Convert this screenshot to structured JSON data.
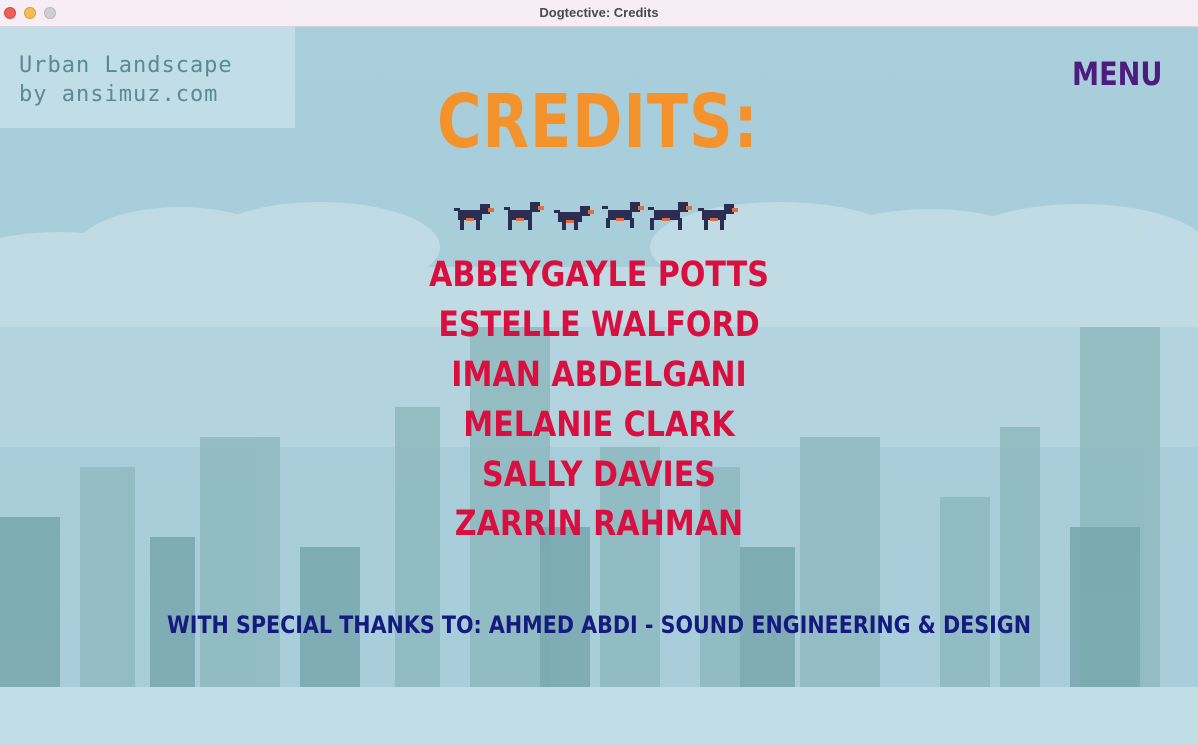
{
  "window": {
    "title": "Dogtective: Credits"
  },
  "attribution": {
    "line1": "Urban Landscape",
    "line2": "by ansimuz.com"
  },
  "menu_label": "MENU",
  "credits_title": "CREDITS:",
  "dog_sprites": [
    "dog-sprite",
    "dog-sprite",
    "dog-sprite",
    "dog-sprite",
    "dog-sprite",
    "dog-sprite"
  ],
  "names": [
    "ABBEYGAYLE POTTS",
    "ESTELLE WALFORD",
    "IMAN ABDELGANI",
    "MELANIE CLARK",
    "SALLY DAVIES",
    "ZARRIN RAHMAN"
  ],
  "special_thanks": "WITH SPECIAL THANKS TO: AHMED ABDI - SOUND ENGINEERING & DESIGN",
  "colors": {
    "sky": "#a9cfdb",
    "title": "#f4922c",
    "names": "#d9103f",
    "menu": "#4d1c7e",
    "thanks": "#141a7f"
  }
}
